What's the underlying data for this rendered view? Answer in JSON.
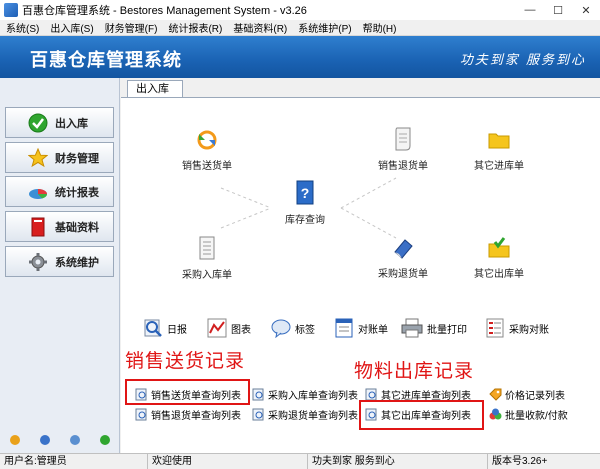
{
  "window": {
    "title": "百惠仓库管理系统 - Bestores Management System - v3.26",
    "controls": [
      "—",
      "☐",
      "✕"
    ]
  },
  "menu": [
    "系统(S)",
    "出入库(S)",
    "财务管理(F)",
    "统计报表(R)",
    "基础资料(R)",
    "系统维护(P)",
    "帮助(H)"
  ],
  "banner": {
    "appname": "百惠仓库管理系统",
    "slogan": "功夫到家 服务到心"
  },
  "nav": [
    {
      "label": "出入库",
      "icon": "check-icon"
    },
    {
      "label": "财务管理",
      "icon": "star-icon"
    },
    {
      "label": "统计报表",
      "icon": "pie-chart-icon"
    },
    {
      "label": "基础资料",
      "icon": "book-icon"
    },
    {
      "label": "系统维护",
      "icon": "gear-icon"
    }
  ],
  "tab": "出入库",
  "flow": {
    "sales_ship": "销售送货单",
    "sales_return": "销售退货单",
    "other_in": "其它进库单",
    "stock_query": "库存查询",
    "purchase_in": "采购入库单",
    "purchase_return": "采购退货单",
    "other_out": "其它出库单"
  },
  "tools": [
    "日报",
    "图表",
    "标签",
    "对账单",
    "批量打印",
    "采购对账"
  ],
  "annotations": {
    "left": "销售送货记录",
    "right": "物料出库记录"
  },
  "links": {
    "r1": [
      "销售送货单查询列表",
      "采购入库单查询列表",
      "其它进库单查询列表",
      "价格记录列表"
    ],
    "r2": [
      "销售退货单查询列表",
      "采购退货单查询列表",
      "其它出库单查询列表",
      "批量收款/付款"
    ]
  },
  "status": {
    "user": "用户名:管理员",
    "welcome": "欢迎使用",
    "slogan": "功夫到家 服务到心",
    "version": "版本号3.26+"
  },
  "colors": {
    "banner": "#1a62b3",
    "annotation": "#e01515"
  }
}
